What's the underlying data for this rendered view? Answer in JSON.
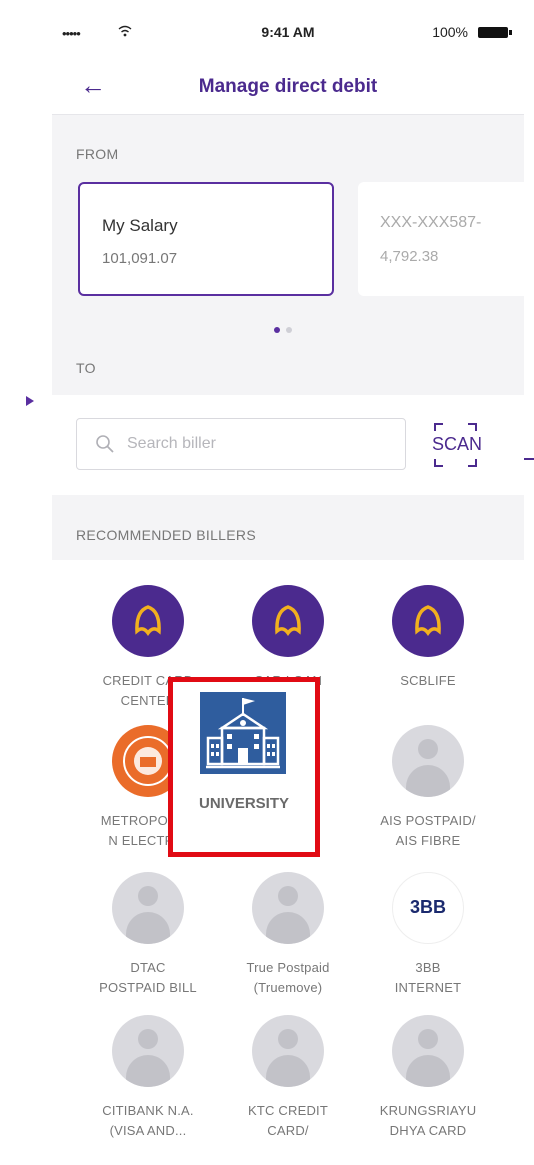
{
  "status_bar": {
    "signal": "•••••",
    "time": "9:41 AM",
    "battery": "100%"
  },
  "header": {
    "back_icon": "arrow-left-icon",
    "title": "Manage direct debit"
  },
  "from": {
    "label": "FROM",
    "accounts": [
      {
        "name": "My Salary",
        "amount": "101,091.07"
      },
      {
        "name": "XXX-XXX587-",
        "amount": "4,792.38"
      }
    ]
  },
  "to": {
    "label": "TO"
  },
  "search": {
    "placeholder": "Search biller",
    "scan_label": "SCAN"
  },
  "recommended": {
    "label": "RECOMMENDED BILLERS",
    "billers": [
      {
        "label_lines": [
          "CREDIT CARD",
          "CENTER"
        ],
        "icon": "scb-bell-icon"
      },
      {
        "label_lines": [
          "CAR LOAN"
        ],
        "icon": "scb-bell-icon"
      },
      {
        "label_lines": [
          "SCBLIFE"
        ],
        "icon": "scb-bell-icon"
      },
      {
        "label_lines": [
          "METROPOLITA",
          "N ELECTRIC"
        ],
        "icon": "mea-seal-icon"
      },
      {
        "label_lines": [
          "UNIVERSITY"
        ],
        "icon": "university-building-icon"
      },
      {
        "label_lines": [
          "AIS POSTPAID/",
          "AIS FIBRE"
        ],
        "icon": "avatar-placeholder-icon"
      },
      {
        "label_lines": [
          "DTAC",
          "POSTPAID BILL"
        ],
        "icon": "avatar-placeholder-icon"
      },
      {
        "label_lines": [
          "True Postpaid",
          "(Truemove)"
        ],
        "icon": "avatar-placeholder-icon"
      },
      {
        "label_lines": [
          "3BB",
          "INTERNET"
        ],
        "icon": "3bb-logo-icon",
        "logo_text": "3BB"
      },
      {
        "label_lines": [
          "CITIBANK N.A.",
          "(VISA AND..."
        ],
        "icon": "avatar-placeholder-icon"
      },
      {
        "label_lines": [
          "KTC CREDIT",
          "CARD/"
        ],
        "icon": "avatar-placeholder-icon"
      },
      {
        "label_lines": [
          "KRUNGSRIAYU",
          "DHYA CARD"
        ],
        "icon": "avatar-placeholder-icon"
      }
    ]
  },
  "colors": {
    "brand_purple": "#4b2a8e",
    "highlight_red": "#e10b14",
    "university_blue": "#2f5d9e"
  }
}
